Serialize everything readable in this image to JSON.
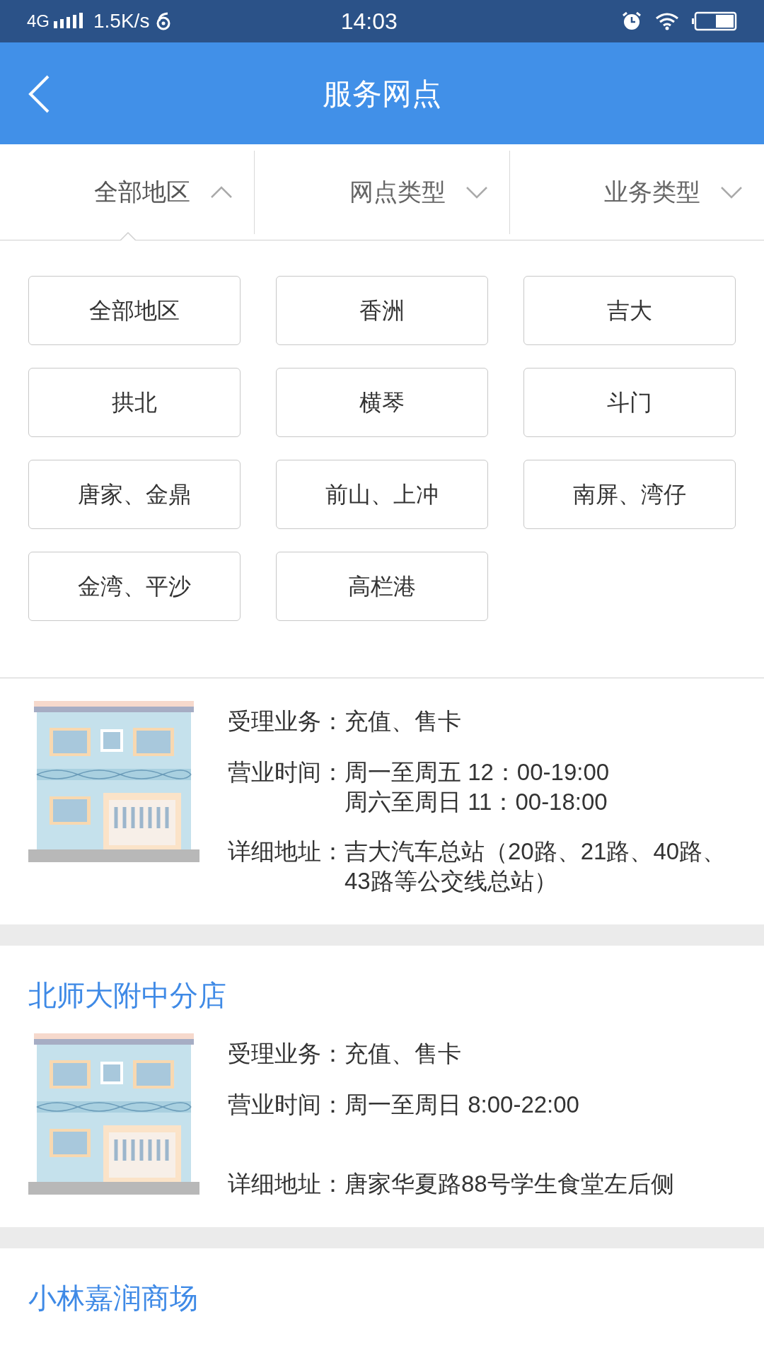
{
  "status_bar": {
    "network": "4G",
    "speed": "1.5K/s",
    "time": "14:03"
  },
  "header": {
    "title": "服务网点"
  },
  "filters": [
    {
      "label": "全部地区",
      "expanded": true
    },
    {
      "label": "网点类型",
      "expanded": false
    },
    {
      "label": "业务类型",
      "expanded": false
    }
  ],
  "regions": [
    "全部地区",
    "香洲",
    "吉大",
    "拱北",
    "横琴",
    "斗门",
    "唐家、金鼎",
    "前山、上冲",
    "南屏、湾仔",
    "金湾、平沙",
    "高栏港"
  ],
  "outlets": [
    {
      "rows": [
        {
          "kind": "services",
          "label": "受理业务：",
          "lines": [
            "充值、售卡"
          ]
        },
        {
          "kind": "hours",
          "label": "营业时间：",
          "lines": [
            "周一至周五 12：00-19:00",
            "周六至周日 11：00-18:00"
          ]
        },
        {
          "kind": "address",
          "label": "详细地址：",
          "lines": [
            "吉大汽车总站（20路、21路、40路、43路等公交线总站）"
          ]
        }
      ]
    },
    {
      "name": "北师大附中分店",
      "rows": [
        {
          "kind": "services",
          "label": "受理业务：",
          "lines": [
            "充值、售卡"
          ]
        },
        {
          "kind": "hours",
          "label": "营业时间：",
          "lines": [
            "周一至周日 8:00-22:00"
          ]
        },
        {
          "kind": "address",
          "label": "详细地址：",
          "lines": [
            "唐家华夏路88号学生食堂左后侧"
          ]
        }
      ]
    },
    {
      "name": "小林嘉润商场"
    }
  ]
}
